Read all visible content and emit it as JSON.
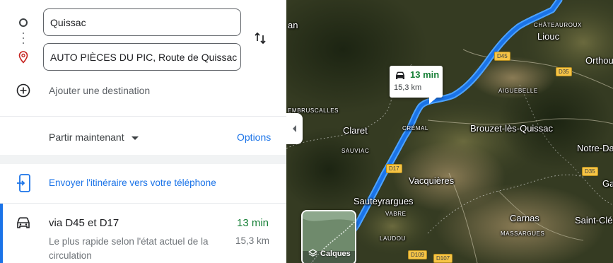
{
  "directions": {
    "origin": "Quissac",
    "destination": "AUTO PIÈCES DU PIC, Route de Quissac",
    "add_destination": "Ajouter une destination",
    "depart_label": "Partir maintenant",
    "options_label": "Options",
    "send_to_phone": "Envoyer l'itinéraire vers votre téléphone"
  },
  "route": {
    "name": "via D45 et D17",
    "time": "13 min",
    "description": "Le plus rapide selon l'état actuel de la circulation",
    "distance": "15,3 km"
  },
  "map": {
    "callout_time": "13 min",
    "callout_distance": "15,3 km",
    "layers_label": "Calques",
    "towns": {
      "lioucc": "Liouc",
      "orthoux": "Orthou",
      "claret": "Claret",
      "brouzet": "Brouzet-lès-Quissac",
      "notre_dame": "Notre-Da",
      "vacquieres": "Vacquières",
      "sauteyrargues": "Sauteyrargues",
      "carnas": "Carnas",
      "saint_cle": "Saint-Clé",
      "ga": "Ga",
      "an": "an"
    },
    "localities": {
      "chateauroux": "CHÂTEAUROUX",
      "aiguebelle": "AIGUEBELLE",
      "embruscalles": "EMBRUSCALLES",
      "cremal": "CRÉMAL",
      "sauviac": "SAUVIAC",
      "vabre": "VABRE",
      "laudou": "LAUDOU",
      "massargues": "MASSARGUES"
    },
    "roads": {
      "d45": "D45",
      "d35a": "D35",
      "d35b": "D35",
      "d17": "D17",
      "d109": "D109",
      "d107": "D107"
    },
    "colors": {
      "route": "#1a73e8",
      "route_glow": "#4da3ff",
      "time_green": "#188038",
      "link_blue": "#1a73e8"
    }
  },
  "icons": {
    "origin": "circle-icon",
    "destination": "map-pin-icon",
    "swap": "swap-vertical-icon",
    "add": "add-circle-icon",
    "phone": "send-to-phone-icon",
    "car": "car-icon",
    "collapse": "chevron-left-icon",
    "layers": "layers-icon"
  }
}
